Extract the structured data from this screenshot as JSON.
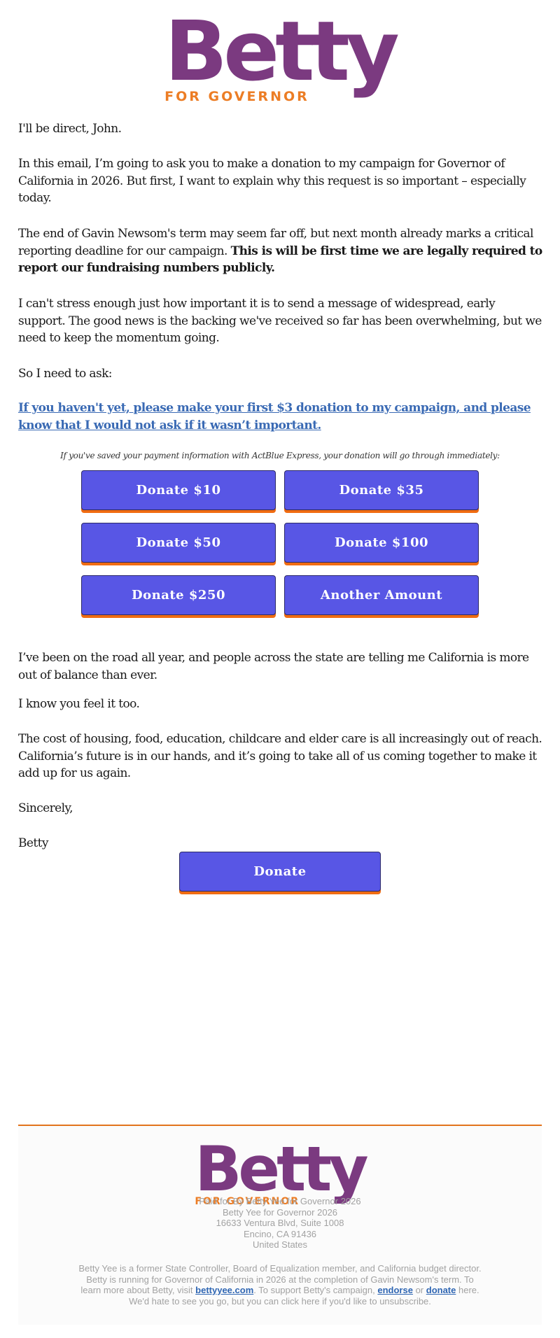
{
  "header": {
    "logo": {
      "word": "Betty",
      "tagline": "FOR GOVERNOR"
    }
  },
  "body": {
    "greeting": "I'll be direct, John.",
    "p1": "In this email, I’m going to ask you to make a donation to my campaign for Governor of California in 2026. But first, I want to explain why this request is so important – especially today.",
    "p2_plain": "The end of Gavin Newsom's term may seem far off, but next month already marks a critical reporting deadline for our campaign. ",
    "p2_bold": "This is will be first time we are legally required to report our fundraising numbers publicly.",
    "p3": "I can't stress enough just how important it is to send a message of widespread, early support. The good news is the backing we've received so far has been overwhelming, but we need to keep the momentum going.",
    "p4": "So I need to ask:",
    "cta_link": "If you haven't yet, please make your first $3 donation to my campaign, and please know that I would not ask if it wasn’t important.",
    "actblue_note": "If you've saved your payment information with ActBlue Express, your donation will go through immediately:",
    "donate_buttons": [
      {
        "label": "Donate $10"
      },
      {
        "label": "Donate $35"
      },
      {
        "label": "Donate $50"
      },
      {
        "label": "Donate $100"
      },
      {
        "label": "Donate $250"
      },
      {
        "label": "Another Amount"
      }
    ],
    "p5": "I’ve been on the road all year, and people across the state are telling me California is more out of balance than ever.",
    "p6": "I know you feel it too.",
    "p7": "The cost of housing, food, education, childcare and elder care is all increasingly out of reach. California’s future is in our hands, and it’s going to take all of us coming together to make it add up for us again.",
    "closing": "Sincerely,",
    "signature": "Betty",
    "final_button": "Donate"
  },
  "footer": {
    "logo": {
      "word": "Betty",
      "tagline": "FOR GOVERNOR"
    },
    "paid_for": "Paid for By Betty Yee for Governor 2026",
    "org": "Betty Yee for Governor 2026",
    "address1": "16633 Ventura Blvd, Suite 1008",
    "address2": "Encino, CA 91436",
    "country": "United States",
    "bio_line1": "Betty Yee is a former State Controller, Board of Equalization member, and California budget director.",
    "bio_line2": "Betty is running for Governor of California in 2026 at the completion of Gavin Newsom's term. To",
    "bio_line3_pre": "learn more about Betty, visit ",
    "site_link": "bettyyee.com",
    "bio_line3_mid": ". To support Betty's campaign, ",
    "endorse_link": "endorse",
    "bio_line3_or": " or ",
    "donate_link": "donate",
    "bio_line3_post": " here.",
    "unsubscribe": "We'd hate to see you go, but you can click here if you'd like to unsubscribe."
  },
  "colors": {
    "brand_purple": "#7b3a80",
    "brand_orange": "#ec7d25",
    "button_fill": "#5856e5",
    "button_shadow": "#f06c12",
    "link": "#3a6ab4",
    "footer_text": "#a2a2a2"
  }
}
